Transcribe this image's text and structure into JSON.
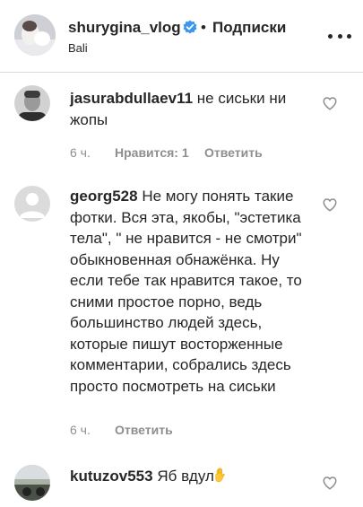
{
  "header": {
    "username": "shurygina_vlog",
    "separator": "•",
    "follow_status": "Подписки",
    "location": "Bali",
    "icons": {
      "verified": "verified-badge-icon",
      "more": "more-options-icon"
    },
    "colors": {
      "verified": "#3897f0",
      "text": "#262626",
      "secondary": "#8e8e8e"
    }
  },
  "comments": [
    {
      "username": "jasurabdullaev11",
      "text": "не сиськи ни жопы",
      "time": "6 ч.",
      "likes": "Нравится: 1",
      "reply": "Ответить"
    },
    {
      "username": "georg528",
      "text": "Не могу понять такие фотки. Вся эта, якобы, \"эстетика тела\", \" не нравится - не смотри\" обыкновенная обнажёнка. Ну если тебе так нравится такое, то сними простое порно, ведь большинство людей здесь, которые пишут восторженные комментарии, собрались здесь просто посмотреть на сиськи",
      "time": "6 ч.",
      "reply": "Ответить"
    },
    {
      "username": "kutuzov553",
      "text": "Яб вдул",
      "emoji": "raised-hand-icon"
    }
  ]
}
